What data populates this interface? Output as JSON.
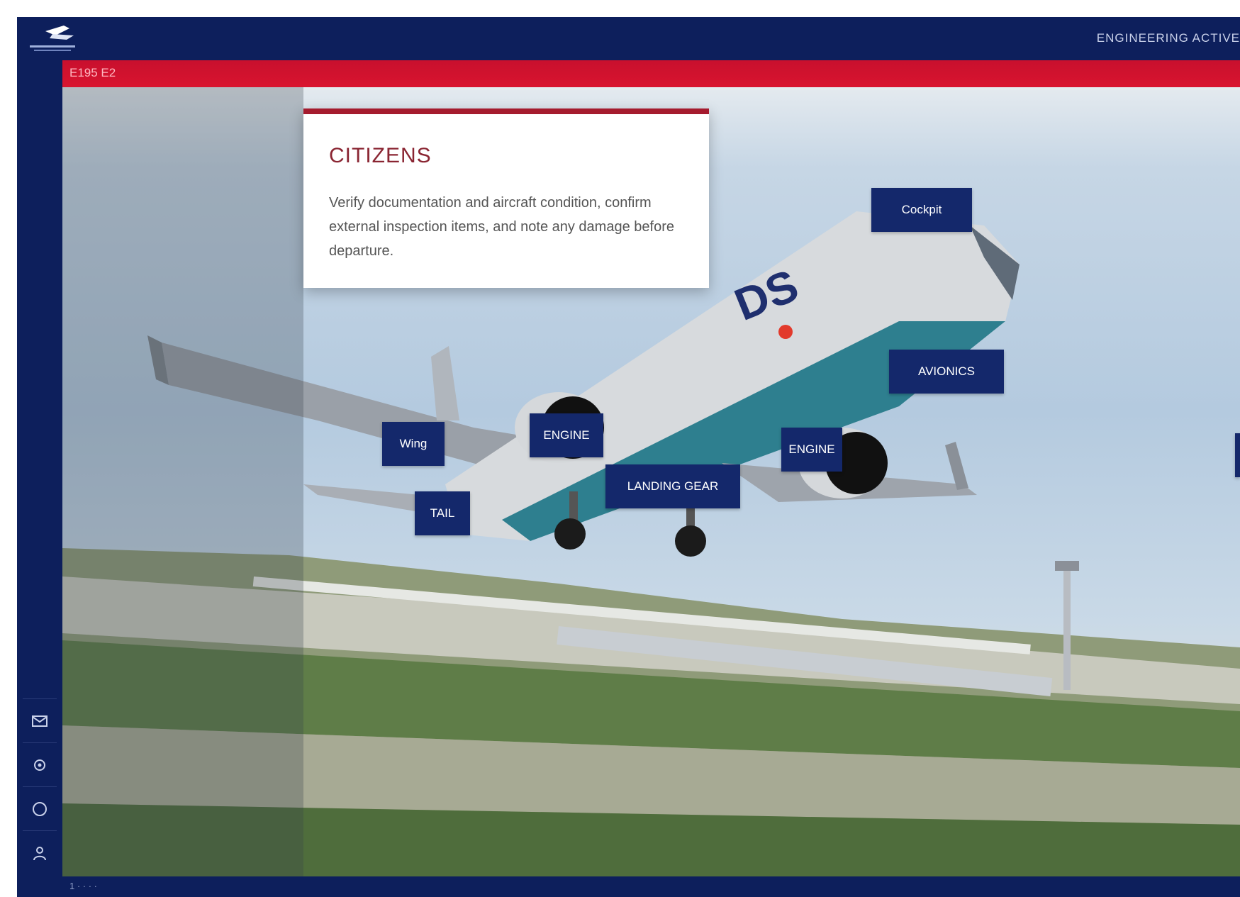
{
  "header": {
    "logo_icon": "airline-logo-icon",
    "nav_text": "ENGINEERING  ACTIVE"
  },
  "section_bar": {
    "label": "E195 E2"
  },
  "info_card": {
    "title": "CITIZENS",
    "body": "Verify documentation and aircraft condition, confirm external inspection items, and note any damage before departure."
  },
  "hotspots": {
    "cockpit": "Cockpit",
    "avionics": "AVIONICS",
    "wing": "Wing",
    "engine_left": "ENGINE",
    "engine_right": "ENGINE",
    "landing_gear": "LANDING GEAR",
    "tail": "TAIL"
  },
  "rail": [
    {
      "icon": "mail-icon"
    },
    {
      "icon": "settings-icon"
    },
    {
      "icon": "search-icon"
    },
    {
      "icon": "user-icon"
    }
  ],
  "status_bar": {
    "text": "1  ·  ·  ·  ·"
  },
  "colors": {
    "navy": "#0d1f5c",
    "red": "#c8102e",
    "hotspot": "#14286b"
  }
}
